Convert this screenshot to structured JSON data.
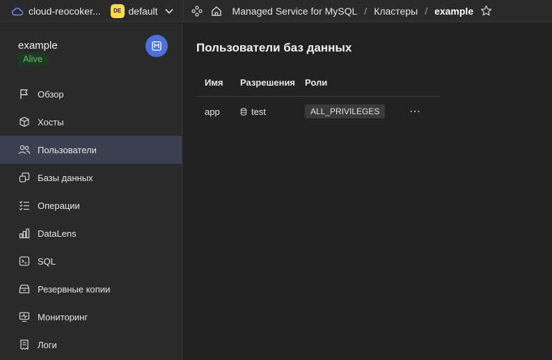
{
  "topbar": {
    "cloud_label": "cloud-reocoker...",
    "folder_badge": "DE",
    "folder_label": "default",
    "breadcrumbs": [
      "Managed Service for MySQL",
      "Кластеры",
      "example"
    ]
  },
  "sidebar": {
    "cluster_name": "example",
    "status": "Alive",
    "items": [
      {
        "label": "Обзор",
        "icon": "flag-icon"
      },
      {
        "label": "Хосты",
        "icon": "cube-icon"
      },
      {
        "label": "Пользователи",
        "icon": "users-icon",
        "active": true
      },
      {
        "label": "Базы данных",
        "icon": "databases-icon"
      },
      {
        "label": "Операции",
        "icon": "list-check-icon"
      },
      {
        "label": "DataLens",
        "icon": "chart-icon"
      },
      {
        "label": "SQL",
        "icon": "terminal-icon"
      },
      {
        "label": "Резервные копии",
        "icon": "archive-icon"
      },
      {
        "label": "Мониторинг",
        "icon": "monitor-icon"
      },
      {
        "label": "Логи",
        "icon": "logs-icon"
      }
    ]
  },
  "main": {
    "title": "Пользователи баз данных",
    "columns": [
      "Имя",
      "Разрешения",
      "Роли"
    ],
    "rows": [
      {
        "name": "app",
        "permission": "test",
        "role": "ALL_PRIVILEGES"
      }
    ]
  },
  "colors": {
    "background": "#222224",
    "panel": "#2a2a2c",
    "active_nav": "#3c4150",
    "status_green": "#5fbd6a",
    "folder_yellow": "#ffdb4d",
    "avatar_blue": "#4a72d8"
  }
}
